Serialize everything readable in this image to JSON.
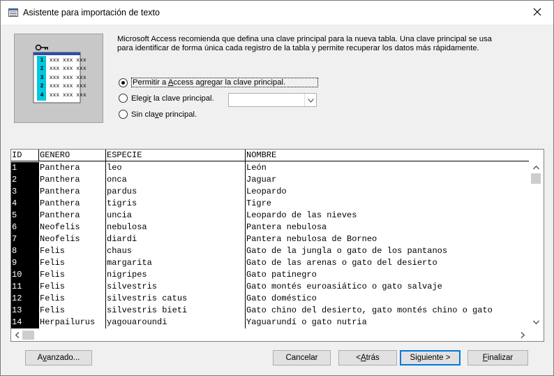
{
  "window": {
    "title": "Asistente para importación de texto"
  },
  "description": "Microsoft Access recomienda que defina una clave principal para la nueva tabla. Una clave principal se usa para identificar de forma única cada registro de la tabla y permite recuperar los datos más rápidamente.",
  "illustration": {
    "rows": [
      "1",
      "2",
      "3",
      "2",
      "4"
    ],
    "cell_text": "xxx xxx xxx"
  },
  "options": [
    {
      "pre": "Permitir a ",
      "key": "A",
      "post": "ccess agregar la clave principal.",
      "selected": true
    },
    {
      "pre": "Elegi",
      "key": "r",
      "post": " la clave principal.",
      "selected": false
    },
    {
      "pre": "Sin cla",
      "key": "v",
      "post": "e principal.",
      "selected": false
    }
  ],
  "combo": {
    "value": ""
  },
  "grid": {
    "headers": [
      "ID",
      "GENERO",
      "ESPECIE",
      "NOMBRE"
    ],
    "rows": [
      [
        "1",
        "Panthera",
        "leo",
        "León"
      ],
      [
        "2",
        "Panthera",
        "onca",
        "Jaguar"
      ],
      [
        "3",
        "Panthera",
        "pardus",
        "Leopardo"
      ],
      [
        "4",
        "Panthera",
        "tigris",
        "Tigre"
      ],
      [
        "5",
        "Panthera",
        "uncia",
        "Leopardo de las nieves"
      ],
      [
        "6",
        "Neofelis",
        "nebulosa",
        "Pantera nebulosa"
      ],
      [
        "7",
        "Neofelis",
        "diardi",
        "Pantera nebulosa de Borneo"
      ],
      [
        "8",
        "Felis",
        "chaus",
        "Gato de la jungla o gato de los pantanos"
      ],
      [
        "9",
        "Felis",
        "margarita",
        "Gato de las arenas o gato del desierto"
      ],
      [
        "10",
        "Felis",
        "nigripes",
        "Gato patinegro"
      ],
      [
        "11",
        "Felis",
        "silvestris",
        "Gato montés euroasiático o gato salvaje"
      ],
      [
        "12",
        "Felis",
        "silvestris catus",
        "Gato doméstico"
      ],
      [
        "13",
        "Felis",
        "silvestris bieti",
        "Gato chino del desierto, gato montés chino o gato"
      ],
      [
        "14",
        "Herpailurus",
        "yagouaroundi",
        "Yaguarundí o gato nutria"
      ]
    ]
  },
  "buttons": {
    "advanced": {
      "pre": "A",
      "key": "v",
      "post": "anzado..."
    },
    "cancel": {
      "pre": "Cancelar",
      "key": "",
      "post": ""
    },
    "back": {
      "pre": "< ",
      "key": "A",
      "post": "trás"
    },
    "next": {
      "pre": "Si",
      "key": "g",
      "post": "uiente >"
    },
    "finish": {
      "pre": "",
      "key": "F",
      "post": "inalizar"
    }
  },
  "colors": {
    "accent": "#0078d7",
    "id_column_bg": "#000000",
    "illustration_bg": "#c8c8c8",
    "illustration_highlight": "#00c8e0"
  },
  "icons": [
    "table-window-icon",
    "close-icon",
    "key-icon",
    "chevron-down-icon",
    "scroll-up-icon",
    "scroll-down-icon",
    "scroll-left-icon",
    "scroll-right-icon"
  ]
}
